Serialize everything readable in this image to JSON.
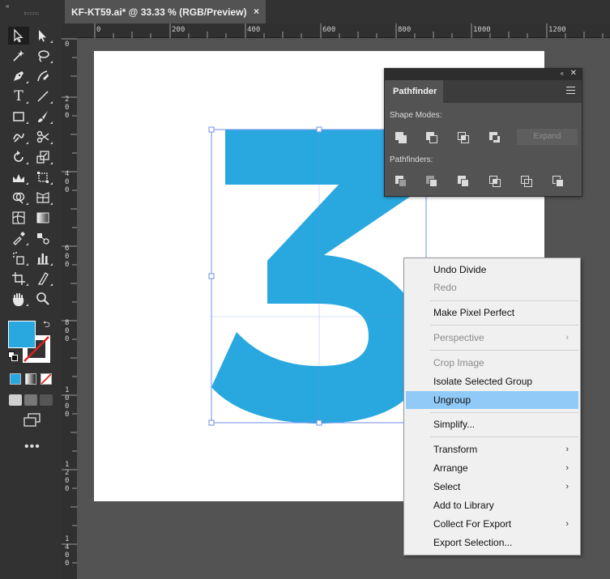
{
  "document_tab": {
    "title": "KF-KT59.ai* @ 33.33 % (RGB/Preview)",
    "close_glyph": "×"
  },
  "toolbar": {
    "collapse_glyph": "«",
    "more_label": "•••",
    "tools": [
      "selection-tool",
      "direct-selection-tool",
      "magic-wand-tool",
      "lasso-tool",
      "pen-tool",
      "curvature-tool",
      "type-tool",
      "line-segment-tool",
      "rectangle-tool",
      "paintbrush-tool",
      "shaper-tool",
      "scissors-tool",
      "rotate-tool",
      "scale-tool",
      "width-tool",
      "free-transform-tool",
      "shape-builder-tool",
      "perspective-grid-tool",
      "mesh-tool",
      "gradient-tool",
      "eyedropper-tool",
      "blend-tool",
      "symbol-sprayer-tool",
      "column-graph-tool",
      "artboard-tool",
      "slice-tool",
      "hand-tool",
      "zoom-tool"
    ],
    "fill_color": "#29a8e0",
    "stroke_color": "none"
  },
  "rulers": {
    "horizontal": [
      "0",
      "200",
      "400",
      "600",
      "800",
      "1000",
      "1200"
    ],
    "vertical": [
      "0",
      "200",
      "400",
      "600",
      "800",
      "1000",
      "1200",
      "1400"
    ]
  },
  "canvas": {
    "glyph": "3",
    "glyph_color": "#29a8e0",
    "selection_color": "#6f8fe8"
  },
  "pathfinder": {
    "tab_label": "Pathfinder",
    "collapse_glyph": "«",
    "close_glyph": "✕",
    "shape_modes_label": "Shape Modes:",
    "pathfinders_label": "Pathfinders:",
    "expand_label": "Expand",
    "shape_mode_buttons": [
      "unite-icon",
      "minus-front-icon",
      "intersect-icon",
      "exclude-icon"
    ],
    "pathfinder_buttons": [
      "divide-icon",
      "trim-icon",
      "merge-icon",
      "crop-icon",
      "outline-icon",
      "minus-back-icon"
    ]
  },
  "context_menu": {
    "items": [
      {
        "label": "Undo Divide",
        "enabled": true,
        "submenu": false
      },
      {
        "label": "Redo",
        "enabled": false,
        "submenu": false
      },
      {
        "label": "Make Pixel Perfect",
        "enabled": true,
        "submenu": false
      },
      {
        "label": "Perspective",
        "enabled": false,
        "submenu": true
      },
      {
        "label": "Crop Image",
        "enabled": false,
        "submenu": false
      },
      {
        "label": "Isolate Selected Group",
        "enabled": true,
        "submenu": false
      },
      {
        "label": "Ungroup",
        "enabled": true,
        "submenu": false,
        "highlighted": true
      },
      {
        "label": "Simplify...",
        "enabled": true,
        "submenu": false
      },
      {
        "label": "Transform",
        "enabled": true,
        "submenu": true
      },
      {
        "label": "Arrange",
        "enabled": true,
        "submenu": true
      },
      {
        "label": "Select",
        "enabled": true,
        "submenu": true
      },
      {
        "label": "Add to Library",
        "enabled": true,
        "submenu": false
      },
      {
        "label": "Collect For Export",
        "enabled": true,
        "submenu": true
      },
      {
        "label": "Export Selection...",
        "enabled": true,
        "submenu": false
      }
    ],
    "submenu_arrow": "›",
    "highlight_color": "#91c9f7"
  }
}
